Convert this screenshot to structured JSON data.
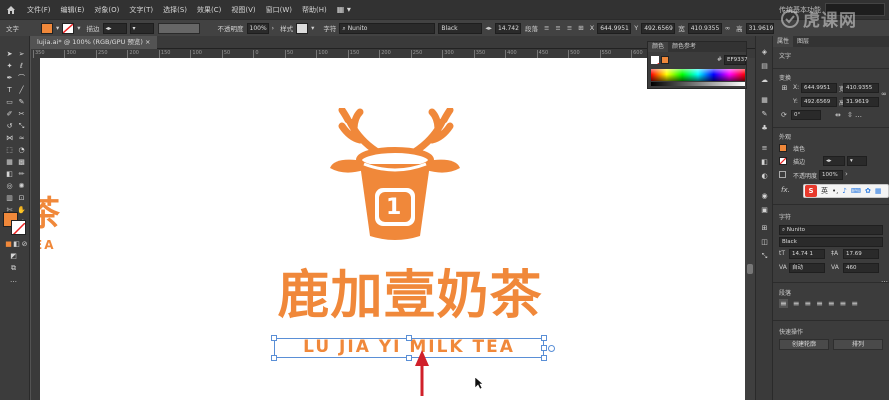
{
  "menubar": {
    "items": [
      "文件(F)",
      "编辑(E)",
      "对象(O)",
      "文字(T)",
      "选择(S)",
      "效果(C)",
      "视图(V)",
      "窗口(W)",
      "帮助(H)"
    ],
    "workspace": "传统基本功能"
  },
  "control": {
    "mode_label": "文字",
    "stroke_label": "描边",
    "opacity_label": "不透明度",
    "opacity_value": "100%",
    "style_label": "样式",
    "char_label": "字符",
    "font_family": "Nunito",
    "font_style": "Black",
    "font_size": "14.742",
    "para_label": "段落",
    "x_label": "X",
    "x_value": "644.9951",
    "y_label": "Y",
    "y_value": "492.6569",
    "w_label": "宽",
    "w_value": "410.9355",
    "h_label": "高",
    "h_value": "31.9619"
  },
  "document": {
    "tab_label": "lujia.ai* @ 100% (RGB/GPU 预览)",
    "ruler_ticks": [
      "350",
      "300",
      "250",
      "200",
      "150",
      "100",
      "50",
      "0",
      "50",
      "100",
      "150",
      "200",
      "250",
      "300",
      "350",
      "400",
      "450",
      "500",
      "550",
      "600",
      "650",
      "700",
      "750"
    ]
  },
  "artwork": {
    "cup_number": "1",
    "chinese_name": "鹿加壹奶茶",
    "english_name": "LU JIA YI MILK TEA",
    "left_partial_chars": "茶",
    "left_partial_latin": "EA",
    "brand_color": "#F0883A"
  },
  "color_panel": {
    "tabs": [
      "颜色",
      "颜色参考"
    ],
    "hex_label": "#",
    "hex_value": "EF9337"
  },
  "properties": {
    "tabs": [
      "属性",
      "图层"
    ],
    "section_type": "文字",
    "section_transform": "变换",
    "x_label": "X:",
    "x_value": "644.9951",
    "y_label": "Y:",
    "y_value": "492.6569",
    "w_label": "宽:",
    "w_value": "410.9355",
    "h_label": "高:",
    "h_value": "31.9619",
    "rotate_value": "0°",
    "section_appearance": "外观",
    "fill_label": "填色",
    "stroke_label": "描边",
    "opacity_label": "不透明度",
    "opacity_value": "100%",
    "fx_label": "fx.",
    "section_char": "字符",
    "font_family": "Nunito",
    "font_style": "Black",
    "font_size": "14.74 1",
    "leading": "17.69",
    "tracking": "自动",
    "kerning": "460",
    "section_para": "段落",
    "section_quick": "快速操作",
    "btn_outline": "创建轮廓",
    "btn_arrange": "排列"
  },
  "ime": {
    "logo": "S",
    "mode": "英"
  },
  "watermark": "虎课网"
}
